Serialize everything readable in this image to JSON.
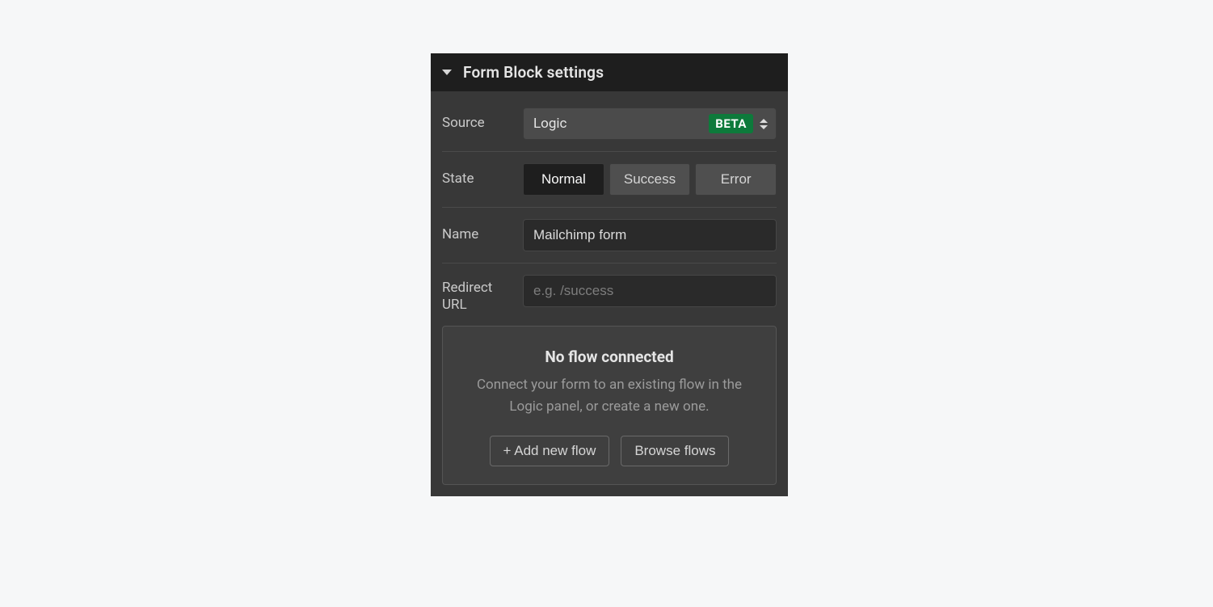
{
  "header": {
    "title": "Form Block settings"
  },
  "source": {
    "label": "Source",
    "value": "Logic",
    "badge": "BETA"
  },
  "state": {
    "label": "State",
    "options": [
      "Normal",
      "Success",
      "Error"
    ],
    "active_index": 0
  },
  "name": {
    "label": "Name",
    "value": "Mailchimp form"
  },
  "redirect": {
    "label": "Redirect URL",
    "placeholder": "e.g. /success",
    "value": ""
  },
  "flow": {
    "title": "No flow connected",
    "description": "Connect your form to an existing flow in the Logic panel, or create a new one.",
    "add_label": "+ Add new flow",
    "browse_label": "Browse flows"
  }
}
